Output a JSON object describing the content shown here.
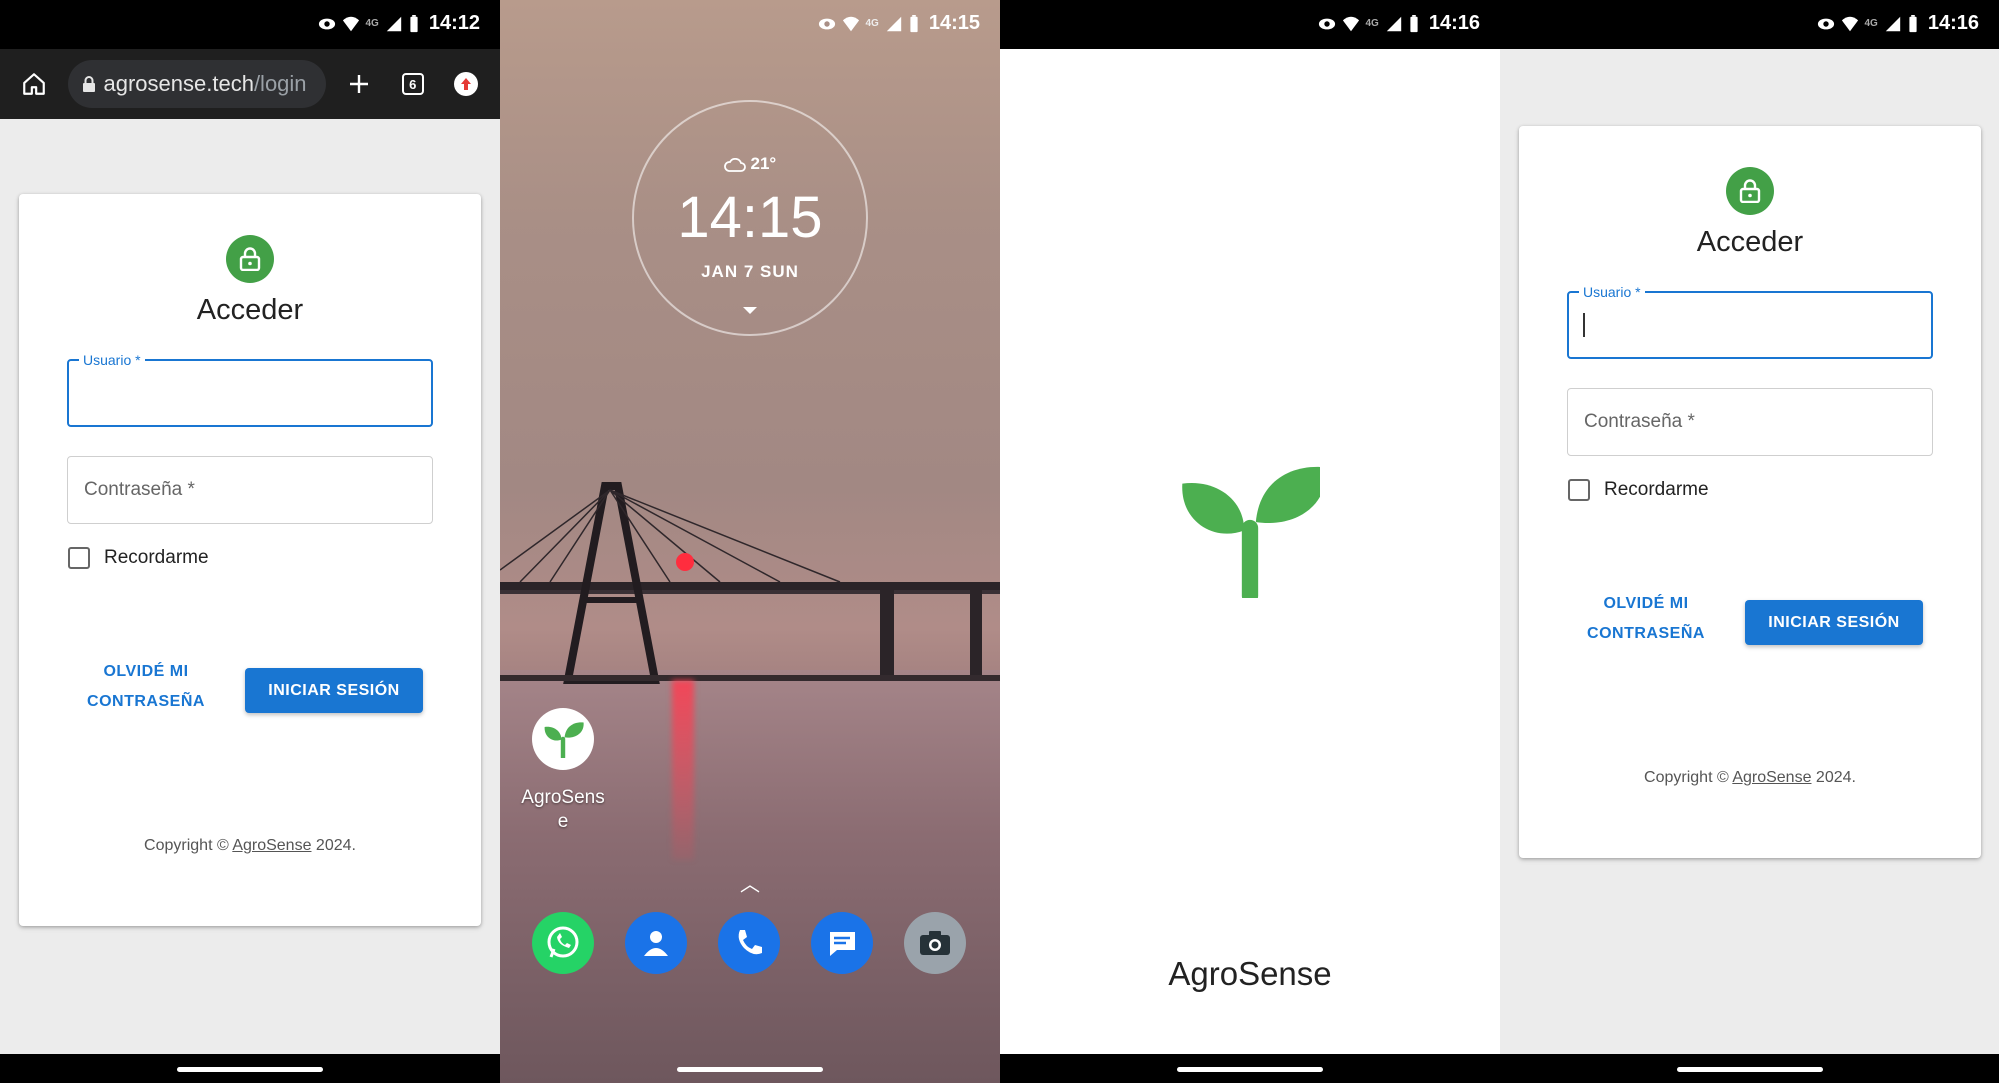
{
  "panel1": {
    "status": {
      "time": "14:12",
      "network": "4G"
    },
    "browser": {
      "url_host": "agrosense.tech",
      "url_path": "/login",
      "tab_count": "6"
    },
    "login": {
      "title": "Acceder",
      "username_label": "Usuario *",
      "password_placeholder": "Contraseña *",
      "remember_label": "Recordarme",
      "forgot_line1": "OLVIDÉ MI",
      "forgot_line2": "CONTRASEÑA",
      "signin_label": "INICIAR SESIÓN",
      "copyright_prefix": "Copyright © ",
      "copyright_link": "AgroSense",
      "copyright_suffix": " 2024."
    }
  },
  "panel2": {
    "status": {
      "time": "14:15",
      "network": "4G"
    },
    "clock": {
      "weather": "21°",
      "time": "14:15",
      "date": "JAN  7  SUN"
    },
    "app": {
      "label_line1": "AgroSens",
      "label_line2": "e"
    },
    "dock": [
      {
        "name": "whatsapp",
        "color": "#25d366"
      },
      {
        "name": "contacts",
        "color": "#1a73e8"
      },
      {
        "name": "phone",
        "color": "#1a73e8"
      },
      {
        "name": "messages",
        "color": "#1a73e8"
      },
      {
        "name": "camera",
        "color": "#9aa3ab"
      }
    ]
  },
  "panel3": {
    "status": {
      "time": "14:16",
      "network": "4G"
    },
    "splash_name": "AgroSense"
  },
  "panel4": {
    "status": {
      "time": "14:16",
      "network": "4G"
    },
    "login": {
      "title": "Acceder",
      "username_label": "Usuario *",
      "password_placeholder": "Contraseña *",
      "remember_label": "Recordarme",
      "forgot_line1": "OLVIDÉ MI",
      "forgot_line2": "CONTRASEÑA",
      "signin_label": "INICIAR SESIÓN",
      "copyright_prefix": "Copyright © ",
      "copyright_link": "AgroSense",
      "copyright_suffix": " 2024."
    }
  },
  "colors": {
    "primary": "#1976d2",
    "lock_green": "#43a047",
    "sprout_green": "#4caf50"
  }
}
